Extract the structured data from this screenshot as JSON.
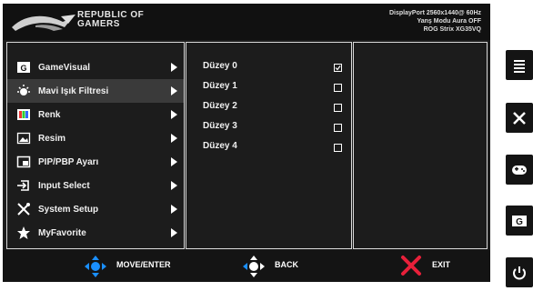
{
  "header": {
    "brand_line1": "REPUBLIC OF",
    "brand_line2": "GAMERS",
    "info_line1": "DisplayPort 2560x1440@ 60Hz",
    "info_line2": "Yanş Modu Aura OFF",
    "info_line3": "ROG Strix XG35VQ"
  },
  "menu": [
    {
      "label": "GameVisual",
      "icon": "gamevisual-icon"
    },
    {
      "label": "Mavi Işık Filtresi",
      "icon": "blue-light-icon",
      "selected": true
    },
    {
      "label": "Renk",
      "icon": "color-icon"
    },
    {
      "label": "Resim",
      "icon": "image-icon"
    },
    {
      "label": "PIP/PBP Ayarı",
      "icon": "pip-icon"
    },
    {
      "label": "Input Select",
      "icon": "input-icon"
    },
    {
      "label": "System Setup",
      "icon": "tools-icon"
    },
    {
      "label": "MyFavorite",
      "icon": "star-icon"
    }
  ],
  "options": [
    {
      "label": "Düzey 0",
      "checked": true
    },
    {
      "label": "Düzey 1",
      "checked": false
    },
    {
      "label": "Düzey 2",
      "checked": false
    },
    {
      "label": "Düzey 3",
      "checked": false
    },
    {
      "label": "Düzey 4",
      "checked": false
    }
  ],
  "footer": {
    "move_enter": "MOVE/ENTER",
    "back": "BACK",
    "exit": "EXIT"
  },
  "colors": {
    "accent_blue": "#1a8fff",
    "exit_red": "#e8203a"
  }
}
